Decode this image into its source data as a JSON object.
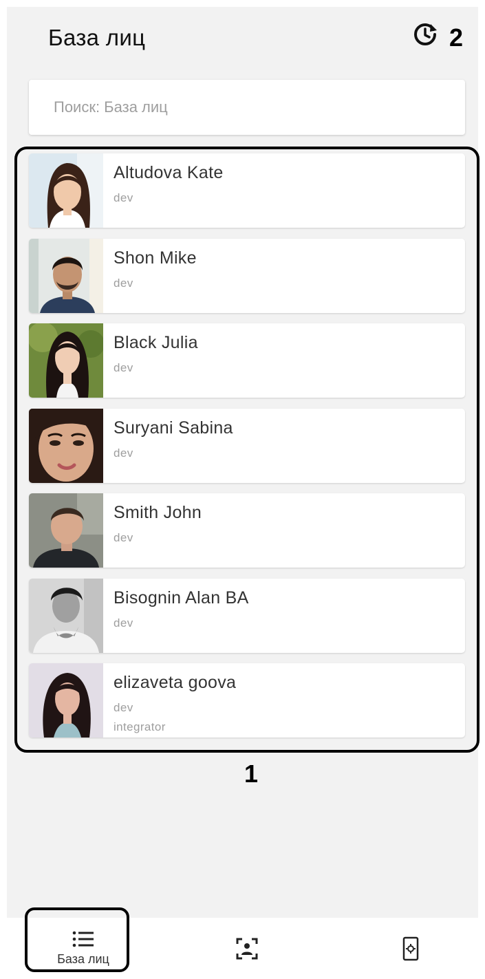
{
  "header": {
    "title": "База лиц",
    "refresh_icon": "refresh-clock-icon"
  },
  "callouts": {
    "list": "1",
    "refresh": "2"
  },
  "search": {
    "placeholder": "Поиск: База лиц",
    "value": ""
  },
  "people": [
    {
      "name": "Altudova Kate",
      "dept": "dev",
      "photo": "woman-dark-hair"
    },
    {
      "name": "Shon Mike",
      "dept": "dev",
      "photo": "man-short-hair"
    },
    {
      "name": "Black Julia",
      "dept": "dev",
      "photo": "woman-long-dark-hair"
    },
    {
      "name": "Suryani Sabina",
      "dept": "dev",
      "photo": "woman-closeup"
    },
    {
      "name": "Smith John",
      "dept": "dev",
      "photo": "man-dark-jacket"
    },
    {
      "name": "Bisognin Alan BA",
      "dept": "dev",
      "photo": "man-grayscale"
    },
    {
      "name": "elizaveta goova",
      "dept": "dev",
      "dept2": "integrator",
      "photo": "woman-dark-hair-light-bg"
    }
  ],
  "bottom_nav": [
    {
      "id": "faces",
      "label": "База лиц",
      "icon": "list-icon",
      "active": true
    },
    {
      "id": "face-scan",
      "label": "",
      "icon": "face-scan-icon",
      "active": false
    },
    {
      "id": "device-settings",
      "label": "",
      "icon": "device-settings-icon",
      "active": false
    }
  ],
  "colors": {
    "background": "#f2f2f2",
    "card": "#ffffff",
    "text_primary": "#333333",
    "text_secondary": "#9e9e9e",
    "annotation": "#000000"
  }
}
